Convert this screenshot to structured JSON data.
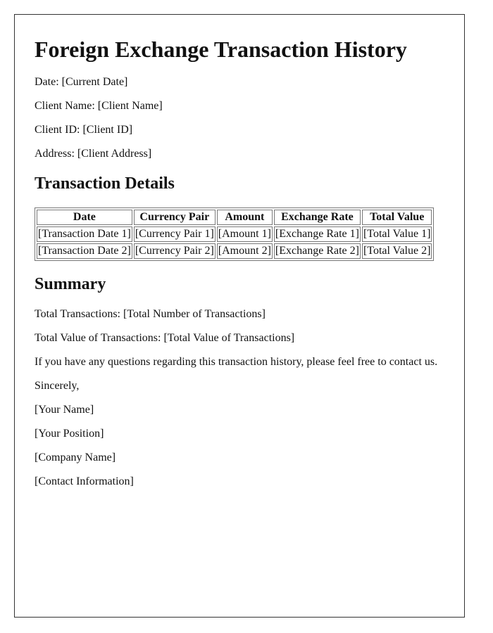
{
  "title": "Foreign Exchange Transaction History",
  "fields": {
    "date": "Date: [Current Date]",
    "client_name": "Client Name: [Client Name]",
    "client_id": "Client ID: [Client ID]",
    "address": "Address: [Client Address]"
  },
  "transaction_details": {
    "heading": "Transaction Details",
    "columns": [
      "Date",
      "Currency Pair",
      "Amount",
      "Exchange Rate",
      "Total Value"
    ],
    "rows": [
      [
        "[Transaction Date 1]",
        "[Currency Pair 1]",
        "[Amount 1]",
        "[Exchange Rate 1]",
        "[Total Value 1]"
      ],
      [
        "[Transaction Date 2]",
        "[Currency Pair 2]",
        "[Amount 2]",
        "[Exchange Rate 2]",
        "[Total Value 2]"
      ]
    ]
  },
  "summary": {
    "heading": "Summary",
    "total_transactions": "Total Transactions: [Total Number of Transactions]",
    "total_value": "Total Value of Transactions: [Total Value of Transactions]",
    "contact_note": "If you have any questions regarding this transaction history, please feel free to contact us."
  },
  "closing": {
    "salutation": "Sincerely,",
    "name": "[Your Name]",
    "position": "[Your Position]",
    "company": "[Company Name]",
    "contact": "[Contact Information]"
  }
}
